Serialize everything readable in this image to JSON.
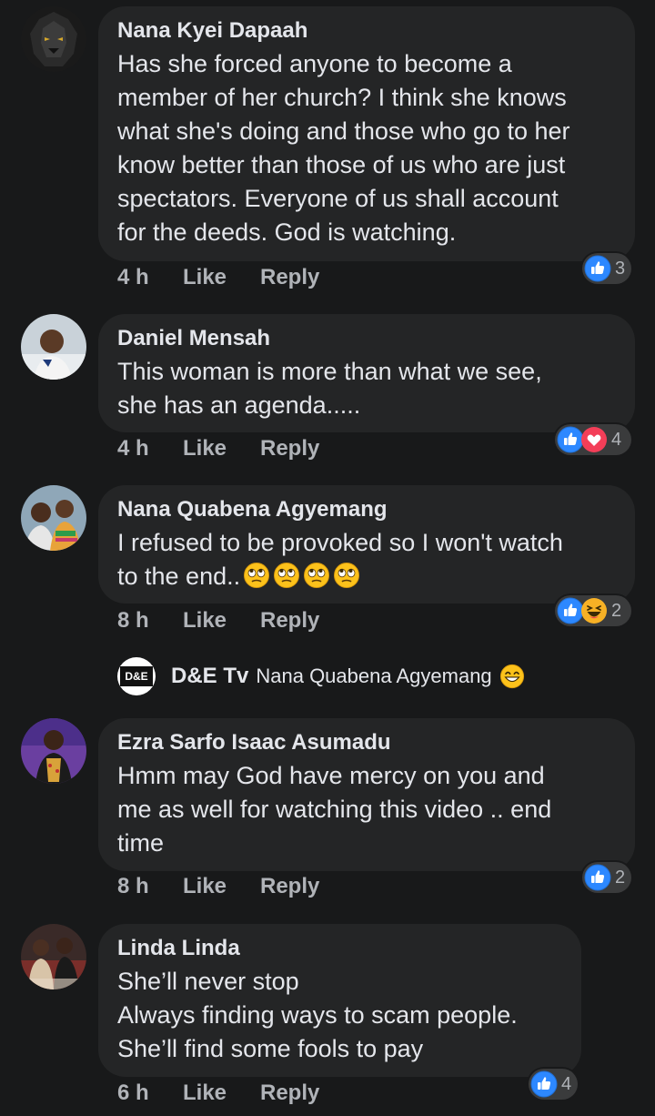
{
  "comments": [
    {
      "author": "Nana Kyei Dapaah",
      "text": "Has she forced anyone to become a\nmember of her church? I think she knows\nwhat she's doing and those who go to her\nknow better than those of us who are just\nspectators. Everyone of us shall account\nfor the deeds. God is watching.",
      "time": "4 h",
      "like": "Like",
      "reply": "Reply",
      "reactions": [
        "like"
      ],
      "reaction_count": "3"
    },
    {
      "author": "Daniel Mensah",
      "text": "This woman is more than what we see,\nshe has an agenda.....",
      "time": "4 h",
      "like": "Like",
      "reply": "Reply",
      "reactions": [
        "like",
        "love"
      ],
      "reaction_count": "4"
    },
    {
      "author": "Nana Quabena Agyemang",
      "text": "I refused to be provoked so I won't watch\nto the end..",
      "text_emojis": [
        "rolling-eyes",
        "rolling-eyes",
        "rolling-eyes",
        "rolling-eyes"
      ],
      "time": "8 h",
      "like": "Like",
      "reply": "Reply",
      "reactions": [
        "like",
        "haha"
      ],
      "reaction_count": "2",
      "reply_preview": {
        "avatar_text": "D&E",
        "author": "D&E Tv",
        "text": "Nana Quabena Agyemang",
        "emoji": "grinning-squint"
      }
    },
    {
      "author": "Ezra Sarfo Isaac Asumadu",
      "text": "Hmm may God have mercy on you and\nme as well for watching this video .. end\ntime",
      "time": "8 h",
      "like": "Like",
      "reply": "Reply",
      "reactions": [
        "like"
      ],
      "reaction_count": "2"
    },
    {
      "author": "Linda Linda",
      "text": "She’ll never stop\nAlways finding ways to scam people.\nShe’ll find some fools to pay",
      "time": "6 h",
      "like": "Like",
      "reply": "Reply",
      "reactions": [
        "like"
      ],
      "reaction_count": "4"
    }
  ],
  "colors": {
    "background": "#18191a",
    "bubble": "#242526",
    "text": "#e4e6eb",
    "secondary_text": "#b0b3b8",
    "like_blue": "#2d88ff",
    "love_red": "#f33e58",
    "haha_yellow": "#f7b125"
  }
}
